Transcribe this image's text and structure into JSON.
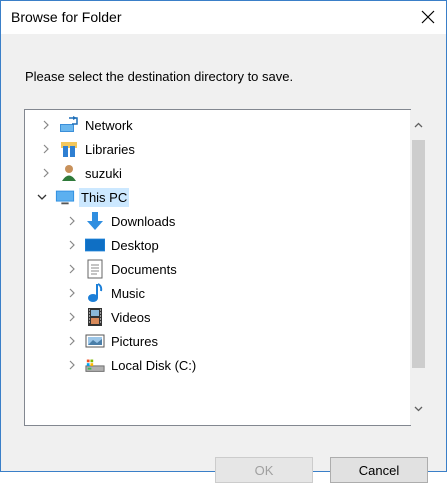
{
  "dialog": {
    "title": "Browse for Folder",
    "prompt": "Please select the destination directory to save."
  },
  "tree": {
    "items": [
      {
        "label": "Network",
        "icon": "network-icon",
        "expanded": false
      },
      {
        "label": "Libraries",
        "icon": "libraries-icon",
        "expanded": false
      },
      {
        "label": "suzuki",
        "icon": "user-icon",
        "expanded": false
      },
      {
        "label": "This PC",
        "icon": "computer-icon",
        "expanded": true,
        "selected": true
      },
      {
        "label": "Downloads",
        "icon": "downloads-icon",
        "expanded": false
      },
      {
        "label": "Desktop",
        "icon": "desktop-icon",
        "expanded": false
      },
      {
        "label": "Documents",
        "icon": "documents-icon",
        "expanded": false
      },
      {
        "label": "Music",
        "icon": "music-icon",
        "expanded": false
      },
      {
        "label": "Videos",
        "icon": "videos-icon",
        "expanded": false
      },
      {
        "label": "Pictures",
        "icon": "pictures-icon",
        "expanded": false
      },
      {
        "label": "Local Disk (C:)",
        "icon": "local-disk-icon",
        "expanded": false
      }
    ]
  },
  "buttons": {
    "ok_label": "OK",
    "cancel_label": "Cancel"
  },
  "colors": {
    "selection": "#cce8ff",
    "border_accent": "#3a7fc8"
  }
}
